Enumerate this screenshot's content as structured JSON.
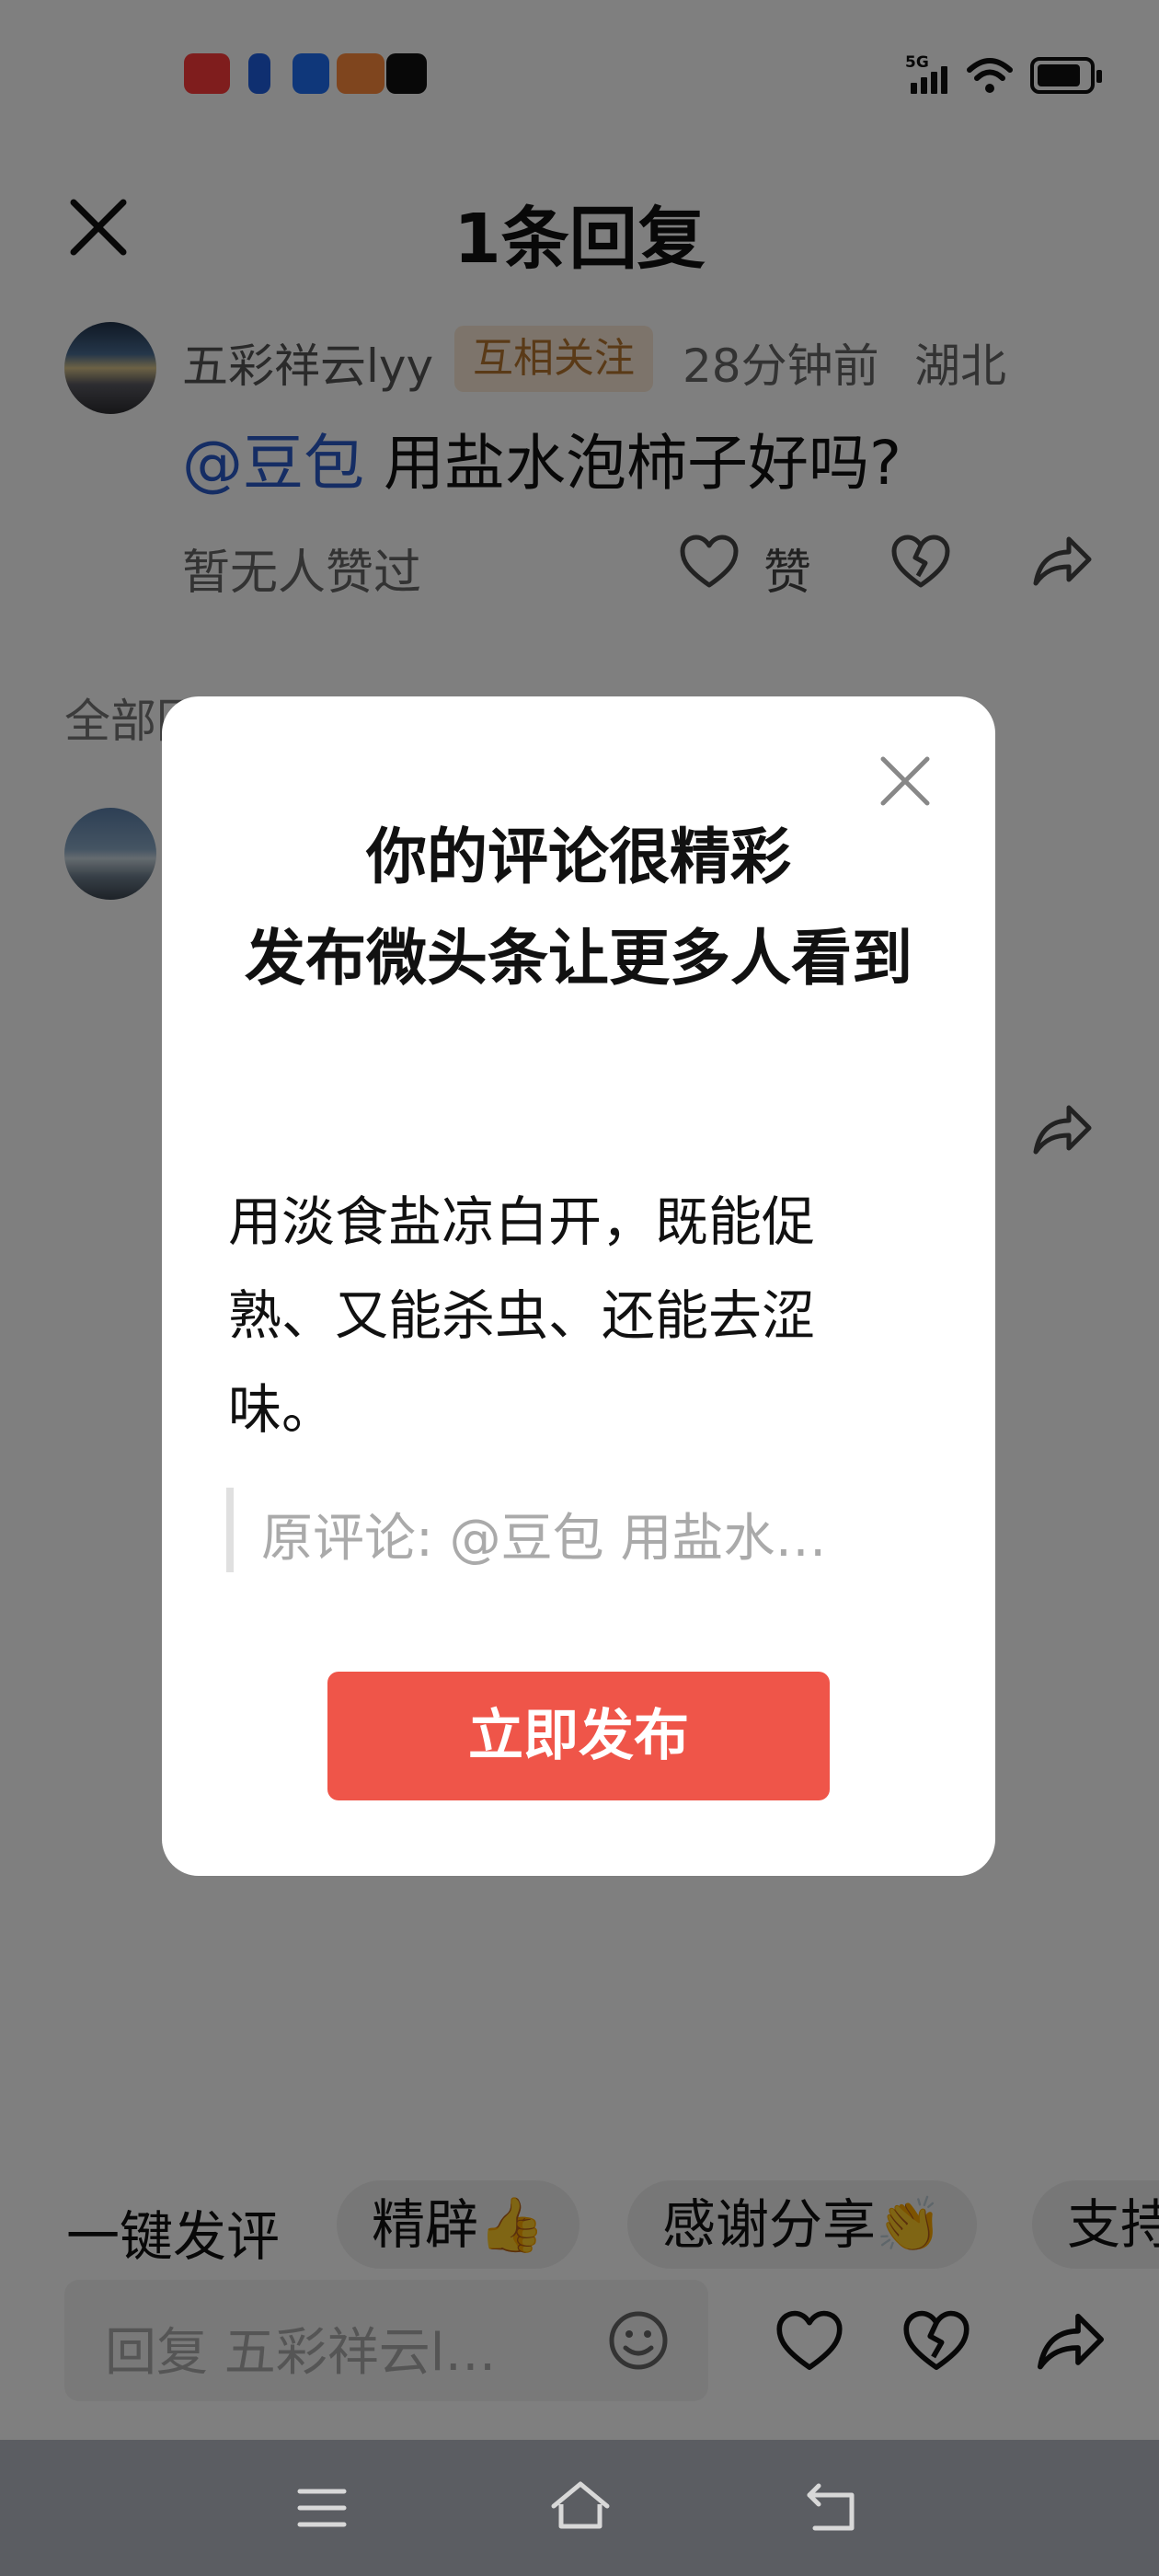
{
  "sheet": {
    "title": "1条回复"
  },
  "comment": {
    "username": "五彩祥云lyy",
    "badge": "互相关注",
    "time": "28分钟前",
    "location": "湖北",
    "mention": "@豆包",
    "text": " 用盐水泡柿子好吗?",
    "no_likes": "暂无人赞过",
    "like_label": "赞"
  },
  "section": {
    "all_replies": "全部回复"
  },
  "quick_comments": {
    "label": "一键发评",
    "chips": [
      "精辟👍",
      "感谢分享👏",
      "支持"
    ]
  },
  "reply": {
    "placeholder": "回复 五彩祥云l…"
  },
  "modal": {
    "title_line1": "你的评论很精彩",
    "title_line2": "发布微头条让更多人看到",
    "body": "用淡食盐凉白开，既能促熟、又能杀虫、还能去涩味。",
    "quote": "原评论: @豆包 用盐水…",
    "publish_button": "立即发布"
  },
  "status_bar": {
    "network": "5G"
  },
  "colors": {
    "accent": "#ef5549",
    "mention": "#2b5ac9",
    "badge_bg": "#fbe9d6",
    "badge_fg": "#b5742e"
  }
}
